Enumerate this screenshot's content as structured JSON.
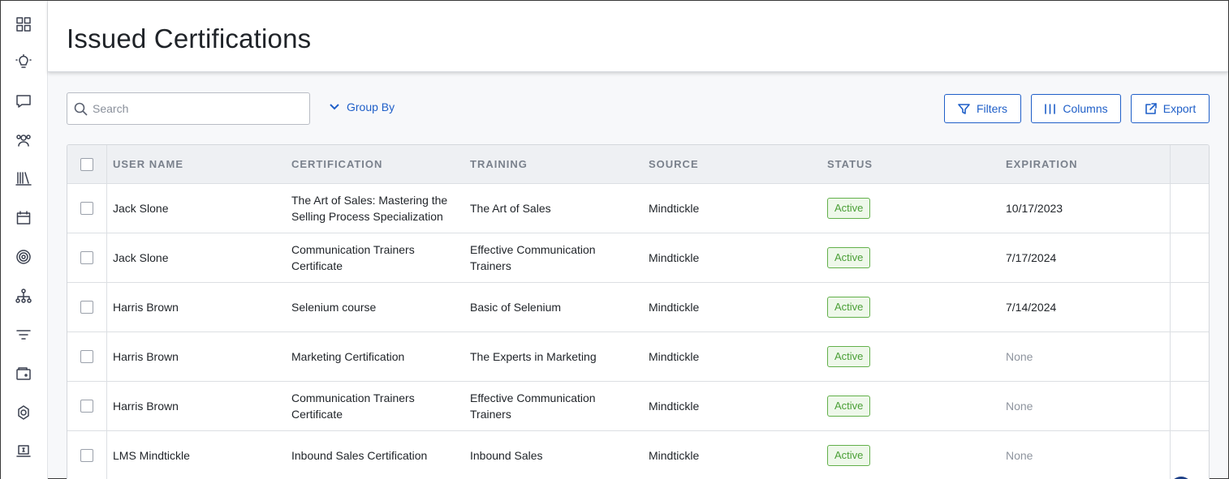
{
  "page": {
    "title": "Issued Certifications"
  },
  "sidebar": {
    "items": [
      {
        "icon": "dashboard-icon"
      },
      {
        "icon": "lightbulb-icon"
      },
      {
        "icon": "chat-icon"
      },
      {
        "icon": "users-icon"
      },
      {
        "icon": "library-icon"
      },
      {
        "icon": "calendar-icon"
      },
      {
        "icon": "target-icon"
      },
      {
        "icon": "hierarchy-icon"
      },
      {
        "icon": "filter-lines-icon"
      },
      {
        "icon": "wallet-icon"
      },
      {
        "icon": "integration-icon"
      },
      {
        "icon": "laptop-icon"
      }
    ]
  },
  "toolbar": {
    "search_placeholder": "Search",
    "group_by_label": "Group By",
    "filters_label": "Filters",
    "columns_label": "Columns",
    "export_label": "Export"
  },
  "table": {
    "headers": {
      "user_name": "USER NAME",
      "certification": "CERTIFICATION",
      "training": "TRAINING",
      "source": "SOURCE",
      "status": "STATUS",
      "expiration": "EXPIRATION"
    },
    "rows": [
      {
        "user": "Jack Slone",
        "certification": "The Art of Sales: Mastering the Selling Process Specialization",
        "training": "The Art of Sales",
        "source": "Mindtickle",
        "status": "Active",
        "expiration": "10/17/2023"
      },
      {
        "user": "Jack Slone",
        "certification": "Communication Trainers Certificate",
        "training": "Effective Communication Trainers",
        "source": "Mindtickle",
        "status": "Active",
        "expiration": "7/17/2024"
      },
      {
        "user": "Harris Brown",
        "certification": "Selenium course",
        "training": "Basic of Selenium",
        "source": "Mindtickle",
        "status": "Active",
        "expiration": "7/14/2024"
      },
      {
        "user": "Harris Brown",
        "certification": "Marketing Certification",
        "training": "The Experts in Marketing",
        "source": "Mindtickle",
        "status": "Active",
        "expiration": "None"
      },
      {
        "user": "Harris Brown",
        "certification": "Communication Trainers Certificate",
        "training": "Effective Communication Trainers",
        "source": "Mindtickle",
        "status": "Active",
        "expiration": "None"
      },
      {
        "user": "LMS Mindtickle",
        "certification": "Inbound Sales Certification",
        "training": "Inbound Sales",
        "source": "Mindtickle",
        "status": "Active",
        "expiration": "None"
      }
    ]
  },
  "colors": {
    "accent": "#1f5fc8",
    "status_active_border": "#62b04a",
    "status_active_text": "#4a9f36"
  }
}
